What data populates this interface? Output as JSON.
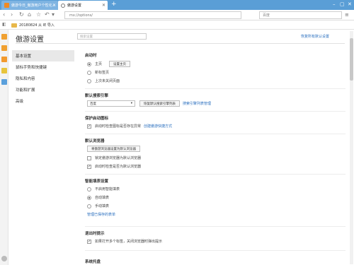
{
  "colors": {
    "tab_bar": "#5a9ed6",
    "link": "#2a6fbf",
    "nav_active": "#e8e8e8"
  },
  "tabs": [
    {
      "title": "傲游今日_傲游用户个性化...",
      "icon": "maxthon-icon"
    },
    {
      "title": "傲游设置",
      "icon": "gear-icon"
    }
  ],
  "address": {
    "url": "mx://options/"
  },
  "search": {
    "placeholder": "百度"
  },
  "bookmarks": [
    {
      "label": "20180824 从 IE 导入"
    }
  ],
  "settings": {
    "title": "傲游设置",
    "search_placeholder": "搜索设置",
    "restore_all": "恢复所有默认设置",
    "nav": [
      "基本设置",
      "鼠标手势和快捷键",
      "隐私和内容",
      "功能和扩展",
      "高级"
    ],
    "startup": {
      "title": "启动时",
      "options": [
        "主页",
        "新标签页",
        "上次未关闭页面"
      ],
      "set_home_btn": "设置主页"
    },
    "search_engine": {
      "title": "默认搜索引擎",
      "selected": "百度",
      "set_default_btn": "恢复默认搜索引擎列表",
      "manage_link": "搜索引擎列表管理"
    },
    "protect": {
      "title": "保护启动图标",
      "check_label": "启动时检查图标是否存在异常",
      "create_link": "创建傲游快捷方式"
    },
    "default_browser": {
      "title": "默认浏览器",
      "set_btn": "将傲游浏览器设置为默认浏览器",
      "options": [
        "锁定傲游浏览器为默认浏览器",
        "启动时检查是否为默认浏览器"
      ]
    },
    "form_fill": {
      "title": "智能填表设置",
      "options": [
        "不启用智能填表",
        "自动填表",
        "手动填表"
      ],
      "manage_link": "管理已保存的表单"
    },
    "exit_prompt": {
      "title": "退出时提示",
      "check_label": "如果打开多个标签，关闭浏览器时弹出提示"
    },
    "tray": {
      "title": "系统托盘"
    }
  }
}
